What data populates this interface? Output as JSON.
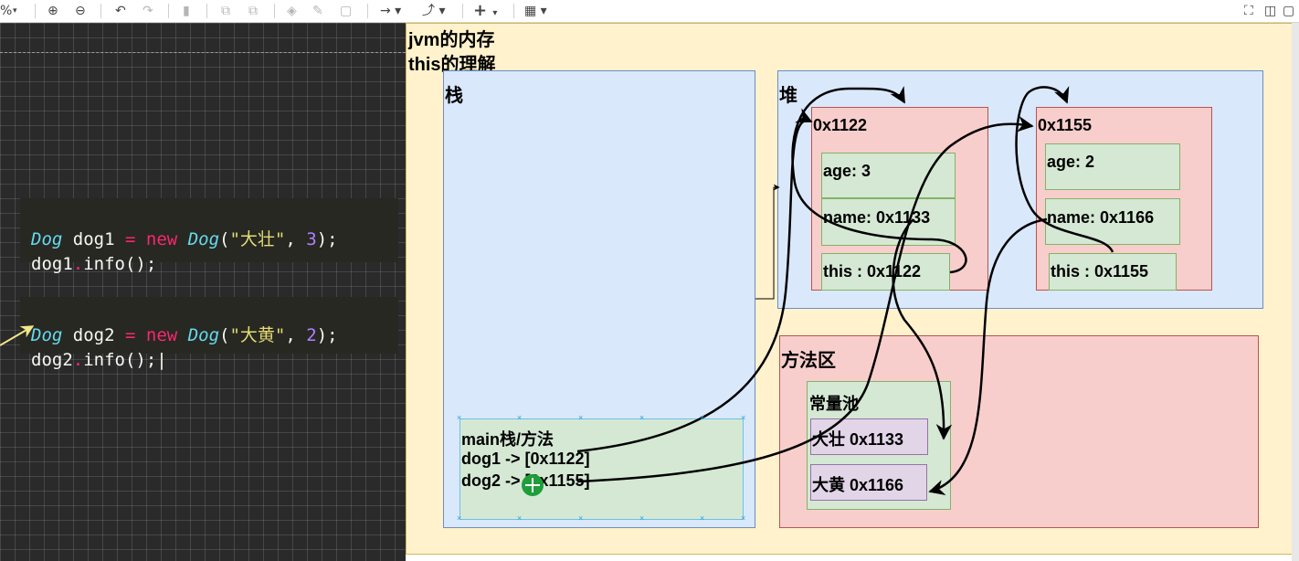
{
  "toolbar": {
    "zoom_label": "%",
    "items": [
      "zoom-in",
      "zoom-out",
      "undo",
      "redo",
      "delete",
      "to-front",
      "to-back",
      "fill-color",
      "line-color",
      "shadow",
      "connection",
      "waypoints",
      "insert",
      "table"
    ]
  },
  "code": {
    "block1": {
      "line1": [
        "Dog",
        "dog1",
        "=",
        "new",
        "Dog",
        "(",
        "\"大壮\"",
        ",",
        "3",
        ");"
      ],
      "line2": [
        "dog1",
        ".",
        "info();"
      ]
    },
    "block2": {
      "line1": [
        "Dog",
        "dog2",
        "=",
        "new",
        "Dog",
        "(",
        "\"大黄\"",
        ",",
        "2",
        ");"
      ],
      "line2": [
        "dog2",
        ".",
        "info();"
      ]
    }
  },
  "diagram": {
    "title1": "jvm的内存",
    "title2": "this的理解",
    "stack": {
      "label": "栈",
      "main": {
        "title": "main栈/方法",
        "dog1": "dog1 -> [0x1122]",
        "dog2": "dog2 -> [0x1155]"
      }
    },
    "heap": {
      "label": "堆",
      "obj1": {
        "addr": "0x1122",
        "age": "age: 3",
        "name": "name: 0x1133",
        "this": "this : 0x1122"
      },
      "obj2": {
        "addr": "0x1155",
        "age": "age: 2",
        "name": "name: 0x1166",
        "this": "this : 0x1155"
      }
    },
    "method_area": {
      "label": "方法区",
      "pool": {
        "label": "常量池",
        "s1": "大壮 0x1133",
        "s2": "大黄 0x1166"
      }
    }
  },
  "colors": {
    "yellow": "#fff2cc",
    "blue": "#dae8fc",
    "pink": "#f8cecc",
    "green": "#d5e8d4",
    "purple": "#e1d5e7"
  }
}
